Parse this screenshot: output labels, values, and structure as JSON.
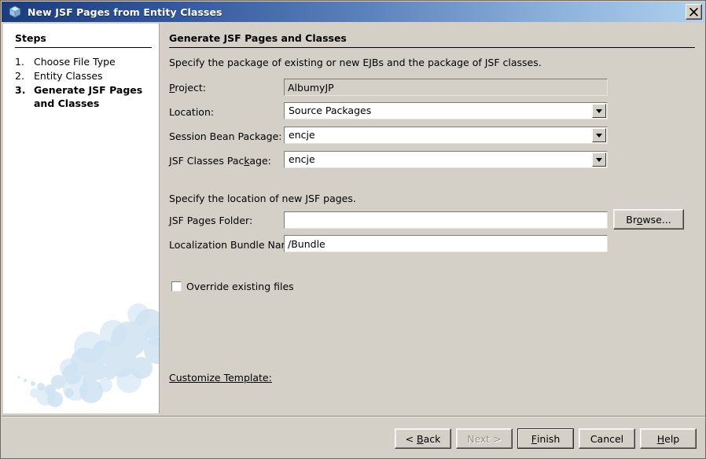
{
  "window": {
    "title": "New JSF Pages from Entity Classes",
    "icon": "cube-icon",
    "close_icon": "close-icon",
    "titlebar_gradient_from": "#1c3c7c",
    "titlebar_gradient_to": "#afd0ee",
    "background": "#d4d0c8"
  },
  "steps_panel": {
    "heading": "Steps",
    "items": [
      {
        "number": "1.",
        "label": "Choose File Type",
        "current": false
      },
      {
        "number": "2.",
        "label": "Entity Classes",
        "current": false
      },
      {
        "number": "3.",
        "label": "Generate JSF Pages and Classes",
        "current": true
      }
    ]
  },
  "content": {
    "heading": "Generate JSF Pages and Classes",
    "intro_packages": "Specify the package of existing or new EJBs and the package of JSF classes.",
    "intro_location": "Specify the location of new JSF pages.",
    "fields": {
      "project": {
        "label_pre": "",
        "label_mnemonic": "P",
        "label_post": "roject:",
        "value": "AlbumyJP",
        "readonly": true
      },
      "location": {
        "label": "Location:",
        "value": "Source Packages"
      },
      "session_bean_package": {
        "label": "Session Bean Package:",
        "value": "encje"
      },
      "jsf_classes_package": {
        "label_a": "",
        "label_mnemonic_1": "J",
        "label_b": "SF Classes Pac",
        "label_mnemonic_2": "k",
        "label_c": "age:",
        "value": "encje"
      },
      "jsf_pages_folder": {
        "label_mnemonic": "J",
        "label_post": "SF Pages Folder:",
        "value": "",
        "placeholder": ""
      },
      "localization_bundle_name": {
        "label": "Localization Bundle Name:",
        "value": "/Bundle"
      }
    },
    "browse_button": {
      "pre": "Br",
      "mnemonic": "o",
      "post": "wse..."
    },
    "override_checkbox": {
      "label": "Override existing files",
      "checked": false
    },
    "customize_link": "Customize Template:"
  },
  "footer": {
    "buttons": [
      {
        "name": "back",
        "pre": "< ",
        "mnemonic": "B",
        "post": "ack",
        "disabled": false,
        "default": false
      },
      {
        "name": "next",
        "pre": "",
        "mnemonic": "N",
        "post": "ext >",
        "disabled": true,
        "default": false
      },
      {
        "name": "finish",
        "pre": "",
        "mnemonic": "F",
        "post": "inish",
        "disabled": false,
        "default": true
      },
      {
        "name": "cancel",
        "pre": "Cancel",
        "mnemonic": "",
        "post": "",
        "disabled": false,
        "default": false
      },
      {
        "name": "help",
        "pre": "",
        "mnemonic": "H",
        "post": "elp",
        "disabled": false,
        "default": false
      }
    ]
  }
}
